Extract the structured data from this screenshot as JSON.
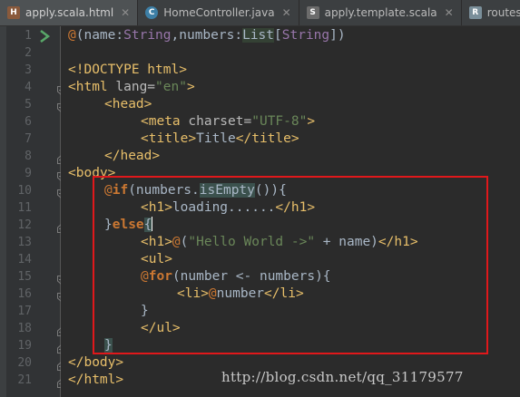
{
  "tabs": [
    {
      "label": "apply.scala.html",
      "icon": "html-file-icon",
      "active": true
    },
    {
      "label": "HomeController.java",
      "icon": "java-class-icon",
      "active": false
    },
    {
      "label": "apply.template.scala",
      "icon": "scala-file-icon",
      "active": false
    },
    {
      "label": "routes",
      "icon": "routes-file-icon",
      "active": false
    }
  ],
  "line_numbers": [
    "1",
    "2",
    "3",
    "4",
    "5",
    "6",
    "7",
    "8",
    "9",
    "10",
    "11",
    "12",
    "13",
    "14",
    "15",
    "16",
    "17",
    "18",
    "19",
    "20",
    "21"
  ],
  "code": {
    "l1": {
      "at": "@",
      "p1": "(name:",
      "t1": "String",
      "p2": ",numbers:",
      "t2": "List",
      "p3": "[",
      "t3": "String",
      "p4": "])"
    },
    "l3": {
      "tag": "<!DOCTYPE html>"
    },
    "l4": {
      "tag1": "<html ",
      "attr": "lang=",
      "str": "\"en\"",
      "tag2": ">"
    },
    "l5": {
      "tag": "<head>"
    },
    "l6": {
      "tag1": "<meta ",
      "attr": "charset=",
      "str": "\"UTF-8\"",
      "tag2": ">"
    },
    "l7": {
      "tag1": "<title>",
      "text": "Title",
      "tag2": "</title>"
    },
    "l8": {
      "tag": "</head>"
    },
    "l9": {
      "tag": "<body>"
    },
    "l10": {
      "at": "@",
      "kw": "if",
      "p1": "(numbers.",
      "meth": "isEmpty",
      "p2": "()){"
    },
    "l11": {
      "tag1": "<h1>",
      "text": "loading......",
      "tag2": "</h1>"
    },
    "l12": {
      "p1": "}",
      "kw": "else",
      "brace": "{"
    },
    "l13": {
      "tag1": "<h1>",
      "at": "@",
      "p1": "(",
      "str": "\"Hello World ->\"",
      "p2": " + name)",
      "tag2": "</h1>"
    },
    "l14": {
      "tag": "<ul>"
    },
    "l15": {
      "at": "@",
      "kw": "for",
      "p1": "(number <- numbers){"
    },
    "l16": {
      "tag1": "<li>",
      "at": "@",
      "p1": "number",
      "tag2": "</li>"
    },
    "l17": {
      "p1": "}"
    },
    "l18": {
      "tag": "</ul>"
    },
    "l19": {
      "brace": "}"
    },
    "l20": {
      "tag": "</body>"
    },
    "l21": {
      "tag": "</html>"
    }
  },
  "watermark": "http://blog.csdn.net/qq_31179577",
  "colors": {
    "background": "#2b2b2b",
    "keyword": "#cc7832",
    "tag": "#e8bf6a",
    "string": "#6a8759",
    "type": "#9876aa",
    "highlight_box": "#e0181b"
  }
}
